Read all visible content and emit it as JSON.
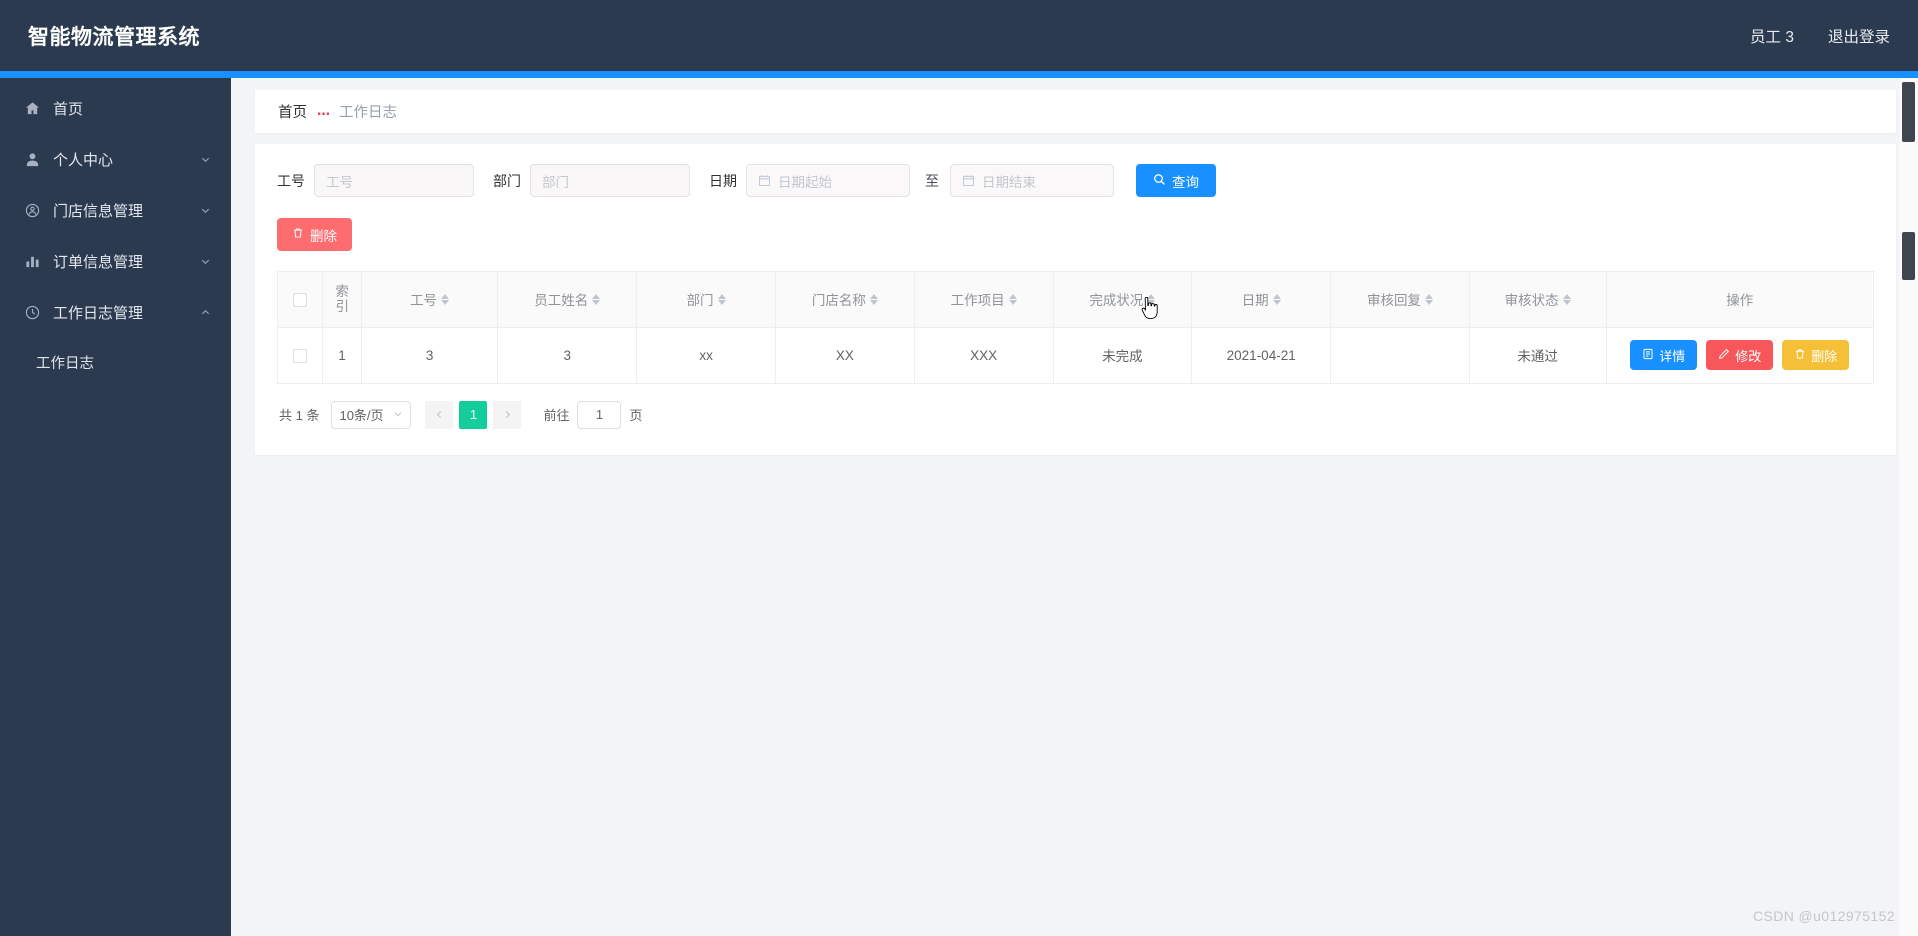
{
  "header": {
    "title": "智能物流管理系统",
    "user_label": "员工 3",
    "logout_label": "退出登录"
  },
  "sidebar": {
    "items": [
      {
        "label": "首页",
        "icon": "home-icon",
        "expandable": false
      },
      {
        "label": "个人中心",
        "icon": "user-icon",
        "expandable": true
      },
      {
        "label": "门店信息管理",
        "icon": "store-circle-icon",
        "expandable": true
      },
      {
        "label": "订单信息管理",
        "icon": "bar-chart-icon",
        "expandable": true
      },
      {
        "label": "工作日志管理",
        "icon": "clock-icon",
        "expandable": true
      }
    ],
    "submenu": [
      {
        "label": "工作日志",
        "parent": "工作日志管理"
      }
    ]
  },
  "breadcrumb": {
    "home": "首页",
    "separator": "…",
    "current": "工作日志"
  },
  "filters": {
    "employee_no": {
      "label": "工号",
      "placeholder": "工号",
      "value": ""
    },
    "department": {
      "label": "部门",
      "placeholder": "部门",
      "value": ""
    },
    "date": {
      "label": "日期",
      "start_placeholder": "日期起始",
      "start_value": "",
      "range_separator": "至",
      "end_placeholder": "日期结束",
      "end_value": ""
    },
    "query_button": "查询"
  },
  "toolbar": {
    "delete_label": "删除"
  },
  "table": {
    "columns": [
      {
        "key": "checkbox",
        "label": "",
        "sortable": false
      },
      {
        "key": "index",
        "label": "索引",
        "sortable": false
      },
      {
        "key": "emp_no",
        "label": "工号",
        "sortable": true
      },
      {
        "key": "emp_name",
        "label": "员工姓名",
        "sortable": true
      },
      {
        "key": "dept",
        "label": "部门",
        "sortable": true
      },
      {
        "key": "store",
        "label": "门店名称",
        "sortable": true
      },
      {
        "key": "project",
        "label": "工作项目",
        "sortable": true
      },
      {
        "key": "status",
        "label": "完成状况",
        "sortable": true
      },
      {
        "key": "date",
        "label": "日期",
        "sortable": true
      },
      {
        "key": "reply",
        "label": "审核回复",
        "sortable": true
      },
      {
        "key": "audit",
        "label": "审核状态",
        "sortable": true
      },
      {
        "key": "actions",
        "label": "操作",
        "sortable": false
      }
    ],
    "rows": [
      {
        "index": "1",
        "emp_no": "3",
        "emp_name": "3",
        "dept": "xx",
        "store": "XX",
        "project": "XXX",
        "status": "未完成",
        "date": "2021-04-21",
        "reply": "",
        "audit": "未通过"
      }
    ],
    "row_actions": {
      "detail": "详情",
      "edit": "修改",
      "delete": "删除"
    }
  },
  "pagination": {
    "total_label": "共 1 条",
    "page_size": "10条/页",
    "prev": "‹",
    "next": "›",
    "current_page": "1",
    "jump_prefix": "前往",
    "jump_value": "1",
    "jump_suffix": "页"
  },
  "watermark": "CSDN @u012975152",
  "colors": {
    "sidebar_bg": "#2c3a50",
    "accent_blue": "#1890ff",
    "danger_red": "#fd6d6f",
    "edit_red": "#f7575b",
    "warn_yellow": "#f5c037",
    "pager_green": "#13ce9a"
  }
}
